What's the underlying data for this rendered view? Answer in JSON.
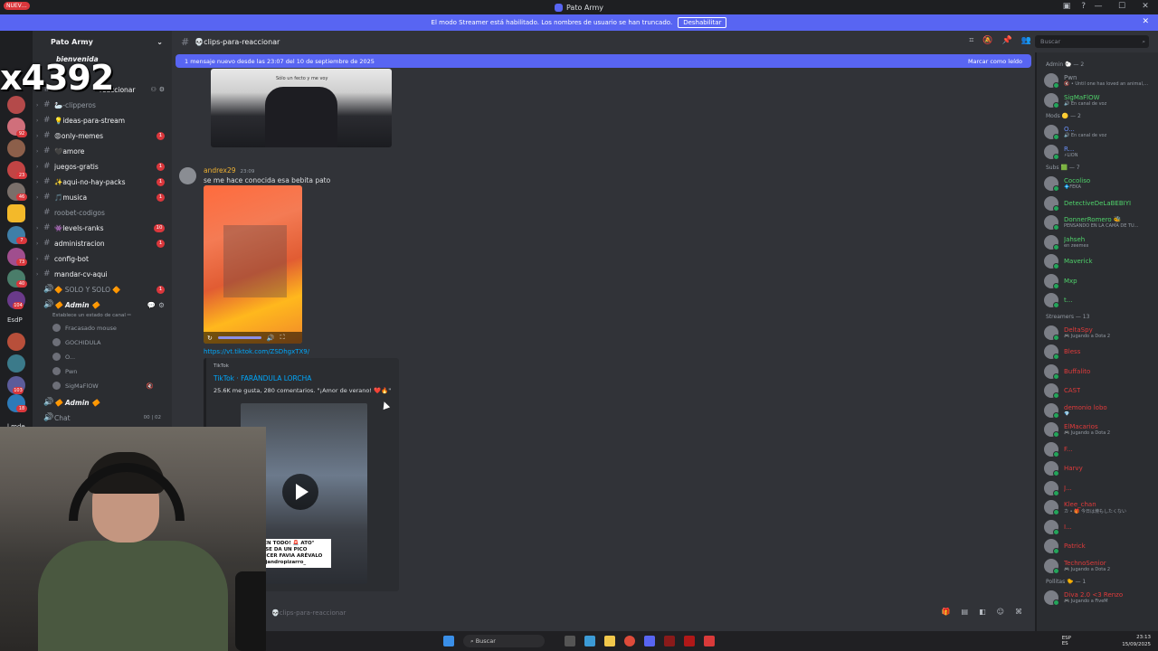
{
  "window": {
    "title": "Pato Army",
    "controls": [
      "—",
      "☐",
      "✕"
    ]
  },
  "banner": {
    "text": "El modo Streamer está habilitado. Los nombres de usuario se han truncado.",
    "button": "Deshabilitar"
  },
  "overlay": {
    "nuevo": "NUEV…",
    "stream_id": "x4392"
  },
  "rail": {
    "esdp": "EsdP",
    "mde": "l mde",
    "badges": [
      "92",
      "23",
      "46",
      "7",
      "73",
      "40",
      "104",
      "103",
      "18"
    ]
  },
  "sidebar": {
    "server_name": "Pato Army",
    "welcome": "bienvenida",
    "channels": [
      {
        "name": "reaccionar",
        "badge": ""
      },
      {
        "name": "🦢-clipperos",
        "badge": ""
      },
      {
        "name": "💡ideas-para-stream",
        "badge": ""
      },
      {
        "name": "😡only-memes",
        "badge": "1"
      },
      {
        "name": "🖤amore",
        "badge": ""
      },
      {
        "name": "juegos-gratis",
        "badge": "1"
      },
      {
        "name": "✨aqui-no-hay-packs",
        "badge": "1"
      },
      {
        "name": "🎵musica",
        "badge": "1"
      },
      {
        "name": "roobet-codigos",
        "badge": ""
      },
      {
        "name": "👾levels-ranks",
        "badge": "10"
      },
      {
        "name": "administracion",
        "badge": "1"
      },
      {
        "name": "config-bot",
        "badge": ""
      },
      {
        "name": "mandar-cv-aqui",
        "badge": ""
      }
    ],
    "voice": {
      "solo": "🔶 SOLO Y SOLO 🔶",
      "solo_badge": "1",
      "admin": "🔶 Admin 🔶",
      "status": "Establece un estado de canal ✏",
      "users": [
        "Fracasado mouse",
        "GOCHIDULA",
        "O...",
        "Pwn",
        "SigMaFlOW"
      ],
      "admin2": "🔶 Admin 🔶",
      "chat": "Chat",
      "chat_counts": "00 | 02"
    }
  },
  "header": {
    "channel": "💀clips-para-reaccionar",
    "search_placeholder": "Buscar"
  },
  "chat": {
    "new_messages": "1 mensaje nuevo desde las 23:07 del 10 de septiembre de 2025",
    "mark_read": "Marcar como leído",
    "prev_image_caption": "Sólo un fecto y me voy",
    "message": {
      "author": "andrex29",
      "time": "23:09",
      "text": "se me hace conocida esa bebita pato",
      "link": "https://vt.tiktok.com/ZSDhgxTX9/",
      "embed": {
        "provider": "TikTok",
        "title": "TikTok · FARÁNDULA LORCHA",
        "description": "25.6K me gusta, 280 comentarios. \"¡Amor de verano! ❤️🔥\"",
        "caption": "🚨 ¡PAREN TODO! 🚨 ATO\" PARODI SE DA UN PICO INFLUENCER FAVIA ARÉVALO IG: @alejandropizarro_"
      }
    },
    "input_placeholder": "💀clips-para-reaccionar"
  },
  "members": {
    "groups": [
      {
        "title": "Admin 🐑 — 2",
        "items": [
          {
            "name": "Pwn",
            "status": "🔇 • Until one has loved an animal,...",
            "color": "#949ba4"
          },
          {
            "name": "SigMaFlOW",
            "status": "🔊 En canal de voz",
            "color": "#4fd16a"
          }
        ]
      },
      {
        "title": "Mods 🟡 — 2",
        "items": [
          {
            "name": "O...",
            "status": "🔊 En canal de voz",
            "color": "#6a8ff5"
          },
          {
            "name": "R...",
            "status": "⚡LION",
            "color": "#6a8ff5"
          }
        ]
      },
      {
        "title": "Subs 🟩 — 7",
        "items": [
          {
            "name": "Cocoliso",
            "status": "💠FEKA",
            "color": "#4fd16a"
          },
          {
            "name": "DetectiveDeLaBEBIYI",
            "status": "",
            "color": "#4fd16a"
          },
          {
            "name": "DonnerRomero 🐝",
            "status": "PENSANDO EN LA CAMA DE TU...",
            "color": "#4fd16a"
          },
          {
            "name": "Jahseh",
            "status": "en zeemex",
            "color": "#4fd16a"
          },
          {
            "name": "Maverick",
            "status": "",
            "color": "#4fd16a"
          },
          {
            "name": "Mxp",
            "status": "",
            "color": "#4fd16a"
          },
          {
            "name": "t...",
            "status": "",
            "color": "#4fd16a"
          }
        ]
      },
      {
        "title": "Streamers — 13",
        "items": [
          {
            "name": "DeltaSpy",
            "status": "🎮 Jugando a Dota 2",
            "color": "#e23b3b"
          },
          {
            "name": "Bless",
            "status": "",
            "color": "#e23b3b"
          },
          {
            "name": "Buffalito",
            "status": "",
            "color": "#e23b3b"
          },
          {
            "name": "CAST",
            "status": "",
            "color": "#e23b3b"
          },
          {
            "name": "demonio lobo",
            "status": "💎",
            "color": "#e23b3b"
          },
          {
            "name": "ElMacarios",
            "status": "🎮 Jugando a Dota 2",
            "color": "#e23b3b"
          },
          {
            "name": "F...",
            "status": "",
            "color": "#e23b3b"
          },
          {
            "name": "Harvy",
            "status": "",
            "color": "#e23b3b"
          },
          {
            "name": "J...",
            "status": "",
            "color": "#e23b3b"
          },
          {
            "name": "Klee_chan",
            "status": "カ • 🎁 今日は焼もしたくない",
            "color": "#e23b3b"
          },
          {
            "name": "I...",
            "status": "",
            "color": "#e23b3b"
          },
          {
            "name": "Patrick",
            "status": "",
            "color": "#e23b3b"
          },
          {
            "name": "TechnoSenior",
            "status": "🎮 Jugando a Dota 2",
            "color": "#e23b3b"
          }
        ]
      },
      {
        "title": "Pollitas 🐤 — 1",
        "items": [
          {
            "name": "Diva 2.0 <3 Renzo",
            "status": "🎮 Jugando a FiveM",
            "color": "#e23b3b"
          }
        ]
      }
    ],
    "tags": [
      "RUST",
      "4K4K",
      "HOP",
      "ser0",
      "MOLY",
      "GAAA",
      "FEKA",
      "ゆウイ"
    ]
  },
  "taskbar": {
    "search": "Buscar",
    "lang": "ESP",
    "lang2": "ES",
    "time": "23:13",
    "date": "15/09/2025"
  },
  "colors": {
    "accent": "#5865f2",
    "bg_dark": "#1e1f22",
    "bg_chat": "#313338",
    "bg_side": "#2b2d31"
  }
}
